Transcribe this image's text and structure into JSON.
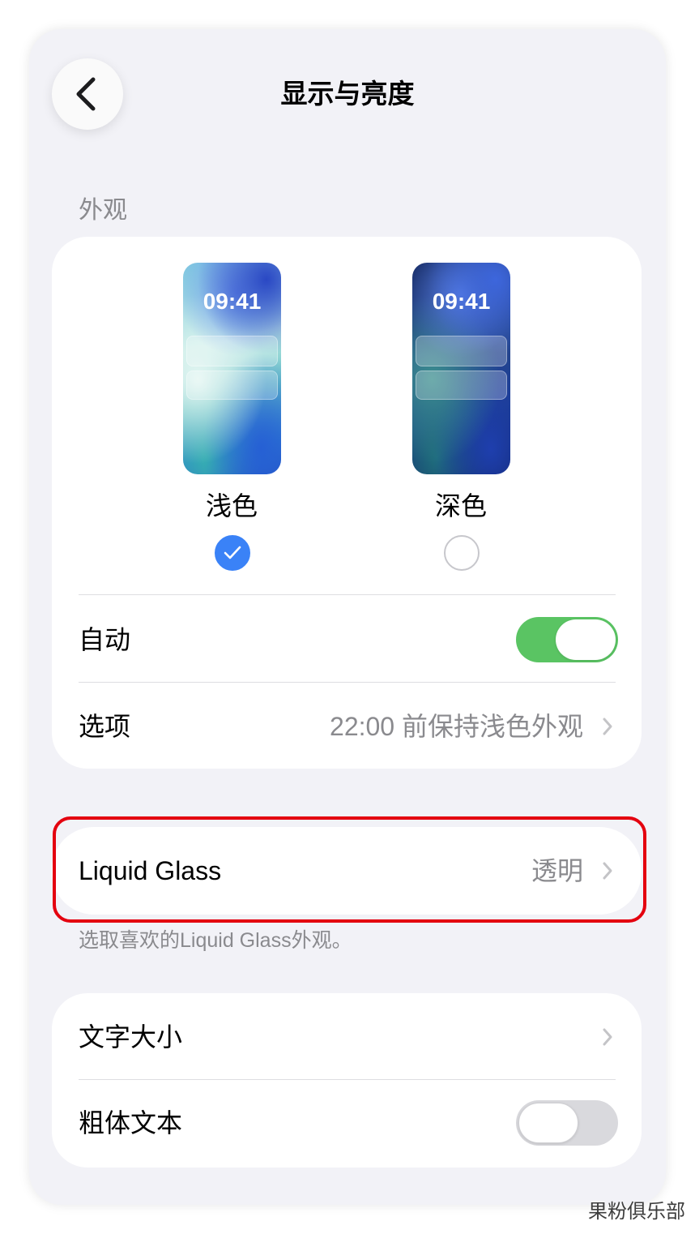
{
  "header": {
    "title": "显示与亮度"
  },
  "appearance": {
    "section_title": "外观",
    "options": [
      {
        "label": "浅色",
        "time": "09:41",
        "selected": true
      },
      {
        "label": "深色",
        "time": "09:41",
        "selected": false
      }
    ],
    "auto": {
      "label": "自动",
      "on": true
    },
    "schedule": {
      "label": "选项",
      "value": "22:00 前保持浅色外观"
    }
  },
  "liquid_glass": {
    "label": "Liquid Glass",
    "value": "透明",
    "footer": "选取喜欢的Liquid Glass外观。"
  },
  "text_settings": {
    "text_size": {
      "label": "文字大小"
    },
    "bold_text": {
      "label": "粗体文本",
      "on": false
    }
  },
  "watermark": "果粉俱乐部",
  "icons": {
    "back": "chevron-left-icon",
    "disclosure": "chevron-right-icon",
    "selected": "checkmark-icon"
  },
  "colors": {
    "background": "#f2f2f7",
    "accent": "#3a82f7",
    "toggle_on": "#5ac463",
    "highlight": "#e4000f",
    "secondary_text": "#8a8a8e"
  }
}
